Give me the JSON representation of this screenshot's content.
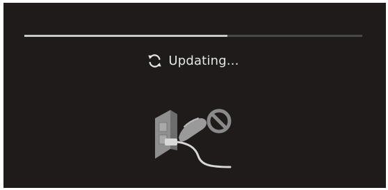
{
  "update_screen": {
    "status_text": "Updating...",
    "progress_fraction": 0.6,
    "sync_icon": "sync-refresh-icon",
    "illustration_icon": "do-not-unplug-power-cord-icon"
  },
  "colors": {
    "background": "#1f1b1a",
    "progress_track": "#4b4848",
    "progress_fill": "#c9c9c9",
    "text": "#e6e6e6"
  }
}
